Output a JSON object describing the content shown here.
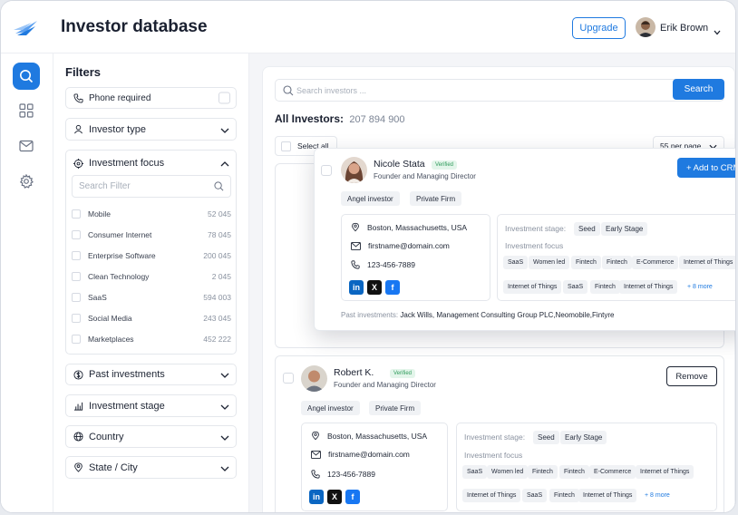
{
  "header": {
    "title": "Investor database",
    "upgrade_label": "Upgrade",
    "user_name": "Erik Brown"
  },
  "rail": {
    "items": [
      "search-icon",
      "grid-icon",
      "mail-icon",
      "settings-icon"
    ]
  },
  "filters": {
    "title": "Filters",
    "phone_required": "Phone required",
    "investor_type": "Investor type",
    "investment_focus": "Investment focus",
    "search_placeholder": "Search Filter",
    "options": [
      {
        "label": "Mobile",
        "count": "52 045"
      },
      {
        "label": "Consumer Internet",
        "count": "78 045"
      },
      {
        "label": "Enterprise Software",
        "count": "200 045"
      },
      {
        "label": "Clean Technology",
        "count": "2 045"
      },
      {
        "label": "SaaS",
        "count": "594 003"
      },
      {
        "label": "Social Media",
        "count": "243 045"
      },
      {
        "label": "Marketplaces",
        "count": "452 222"
      }
    ],
    "past_investments": "Past investments",
    "investment_stage": "Investment stage",
    "country": "Country",
    "state_city": "State / City"
  },
  "main": {
    "search_placeholder": "Search investors ...",
    "search_button": "Search",
    "all_investors_label": "All Investors:",
    "all_investors_count": "207 894 900",
    "select_all": "Select all",
    "per_page": "55 per page"
  },
  "cards": [
    {
      "name": "Nicole Stata",
      "verified": "Verified",
      "role": "Founder and Managing Director",
      "action": "+ Add to CRM",
      "types": [
        "Angel investor",
        "Private Firm"
      ],
      "location": "Boston, Massachusetts, USA",
      "email": "firstname@domain.com",
      "phone": "123-456-7889",
      "stage_label": "Investment stage:",
      "stages": [
        "Seed",
        "Early Stage"
      ],
      "focus_label": "Investment focus",
      "focus_row1": [
        "SaaS",
        "Women led",
        "Fintech",
        "Fintech",
        "E-Commerce",
        "Internet of Things"
      ],
      "focus_row2": [
        "Internet of Things",
        "SaaS",
        "Fintech",
        "Internet of Things"
      ],
      "more": "+ 8 more",
      "past_label": "Past investments:",
      "past_value": "Jack Wills, Management Consulting Group PLC,Neomobile,Fintyre"
    },
    {
      "name": "Robert K.",
      "verified": "Verified",
      "role": "Founder and Managing Director",
      "action": "Remove",
      "types": [
        "Angel investor",
        "Private Firm"
      ],
      "location": "Boston, Massachusetts, USA",
      "email": "firstname@domain.com",
      "phone": "123-456-7889",
      "stage_label": "Investment stage:",
      "stages": [
        "Seed",
        "Early Stage"
      ],
      "focus_label": "Investment focus",
      "focus_row1": [
        "SaaS",
        "Women led",
        "Fintech",
        "Fintech",
        "E-Commerce",
        "Internet of Things"
      ],
      "focus_row2": [
        "Internet of Things",
        "SaaS",
        "Fintech",
        "Internet of Things"
      ],
      "more": "+ 8 more"
    }
  ],
  "colors": {
    "accent": "#1f7ae0",
    "linkedin": "#0a66c2",
    "x": "#111111",
    "facebook": "#1877f2",
    "verified": "#2e9b5b"
  }
}
